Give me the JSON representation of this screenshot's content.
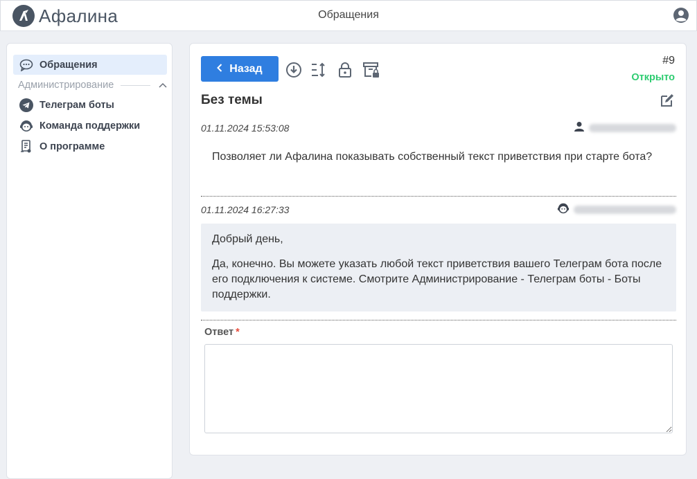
{
  "app": {
    "name": "Афалина",
    "page_title": "Обращения"
  },
  "sidebar": {
    "items": [
      {
        "label": "Обращения",
        "icon": "chat-icon",
        "active": true
      },
      {
        "label": "Телеграм боты",
        "icon": "telegram-icon"
      },
      {
        "label": "Команда поддержки",
        "icon": "support-agent-icon"
      },
      {
        "label": "О программе",
        "icon": "about-document-icon"
      }
    ],
    "section_label": "Администрирование"
  },
  "ticket": {
    "back_label": "Назад",
    "number": "#9",
    "status": "Открыто",
    "subject": "Без темы",
    "status_color": "#2ecc71",
    "accent_color": "#2f7ee0"
  },
  "messages": [
    {
      "date": "01.11.2024 15:53:08",
      "author_icon": "user-icon",
      "text": "Позволяет ли Афалина показывать собственный текст приветствия при старте бота?"
    },
    {
      "date": "01.11.2024 16:27:33",
      "author_icon": "support-agent-icon",
      "paragraphs": [
        "Добрый день,",
        "Да, конечно. Вы можете указать любой текст приветствия вашего Телеграм бота после его подключения к системе. Смотрите Администрирование - Телеграм боты - Боты поддержки."
      ]
    }
  ],
  "reply": {
    "label": "Ответ",
    "required_mark": "*",
    "value": ""
  }
}
